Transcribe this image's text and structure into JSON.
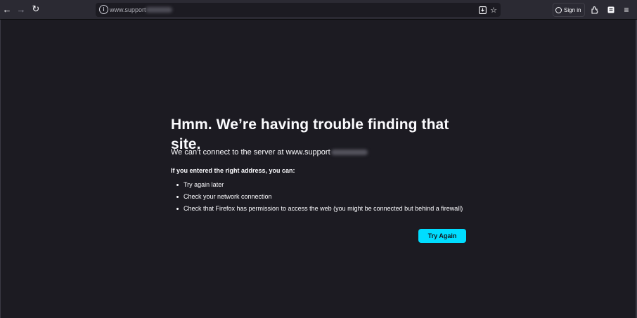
{
  "toolbar": {
    "back_icon": "back-arrow-icon",
    "forward_icon": "forward-arrow-icon",
    "reload_icon": "reload-icon",
    "url_partial": "www.support",
    "sign_in_label": "Sign in"
  },
  "error": {
    "title": "Hmm. We’re having trouble finding that site.",
    "description": "We can’t connect to the server at www.support",
    "subheading": "If you entered the right address, you can:",
    "suggestions": [
      "Try again later",
      "Check your network connection",
      "Check that Firefox has permission to access the web (you might be connected but behind a firewall)"
    ],
    "button_label": "Try Again"
  },
  "colors": {
    "background": "#1c1b22",
    "toolbar": "#2b2a33",
    "accent": "#00ddff"
  }
}
